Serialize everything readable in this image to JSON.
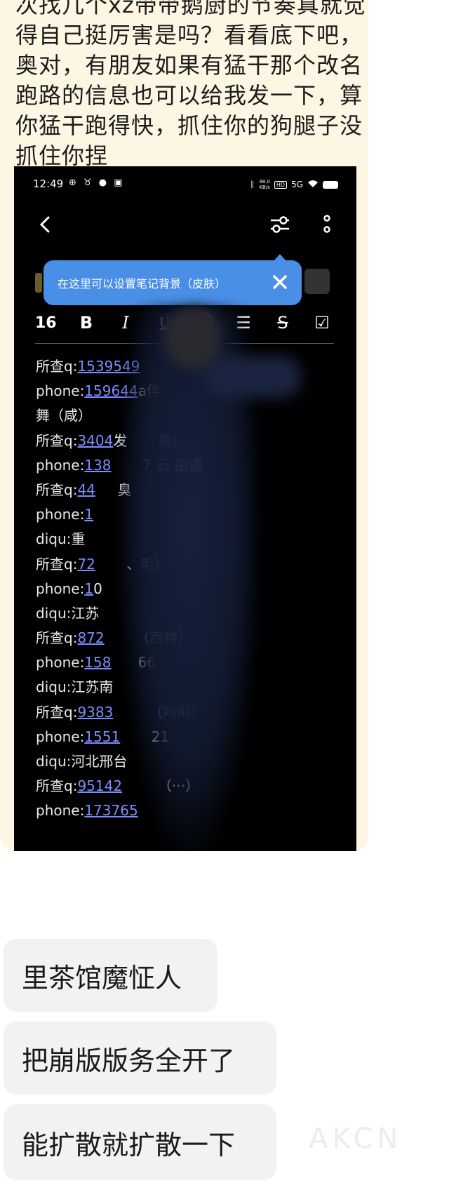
{
  "post": {
    "text": "次找几个xz带带鹅厨的节奏真就觉得自己挺厉害是吗？看看底下吧，奥对，有朋友如果有猛干那个改名跑路的信息也可以给我发一下，算你猛干跑得快，抓住你的狗腿子没抓住你捏"
  },
  "phone": {
    "status_time": "12:49",
    "status_left_icons": "⊕ ♉ ● ▣",
    "net_speed_top": "48.0",
    "net_speed_bottom": "KB/s",
    "hd": "HD",
    "signal": "5G",
    "tooltip": {
      "text": "在这里可以设置笔记背景（皮肤）"
    },
    "format_bar": {
      "font_size": "16",
      "bold": "B",
      "italic": "I",
      "underline": "U",
      "list": "☰",
      "strike": "S",
      "check": "☑"
    },
    "note_lines": [
      {
        "label": "所查q:",
        "num": "1539549",
        "suffix": ""
      },
      {
        "label": "phone:",
        "num": "159644",
        "suffix": "a伴"
      },
      {
        "label": "舞（咸）",
        "num": "",
        "suffix": ""
      },
      {
        "label": "所查q:",
        "num": "3404",
        "suffix": "发       鱼）"
      },
      {
        "label": "phone:",
        "num": "138",
        "suffix": "       7 云 招通"
      },
      {
        "label": "所查q:",
        "num": "44",
        "suffix": "     臭"
      },
      {
        "label": "phone:",
        "num": "1",
        "suffix": ""
      },
      {
        "label": "diqu:重",
        "num": "",
        "suffix": ""
      },
      {
        "label": "所查q:",
        "num": "72",
        "suffix": "       、毛）"
      },
      {
        "label": "phone:",
        "num": "1",
        "suffix": "0"
      },
      {
        "label": "diqu:江苏",
        "num": "",
        "suffix": ""
      },
      {
        "label": "所查q:",
        "num": "872",
        "suffix": "       （西神）"
      },
      {
        "label": "phone:",
        "num": "158",
        "suffix": "      66"
      },
      {
        "label": "diqu:江苏南",
        "num": "",
        "suffix": ""
      },
      {
        "label": "所查q:",
        "num": "9383",
        "suffix": "        （呵呵）"
      },
      {
        "label": "phone:",
        "num": "1551",
        "suffix": "       21"
      },
      {
        "label": "diqu:河北邢台",
        "num": "",
        "suffix": ""
      },
      {
        "label": " 所查q:",
        "num": "95142",
        "suffix": "        （···）"
      },
      {
        "label": "phone:",
        "num": "173765",
        "suffix": ""
      }
    ]
  },
  "messages": [
    {
      "text": "里茶馆魔怔人"
    },
    {
      "text": "把崩版版务全开了"
    },
    {
      "text": "能扩散就扩散一下"
    }
  ],
  "watermark": "AKCN",
  "colors": {
    "card_bg": "#fdf6e3",
    "tooltip_bg": "#4a8fe6",
    "link": "#7b8cff",
    "bubble_bg": "#f2f2f2"
  }
}
